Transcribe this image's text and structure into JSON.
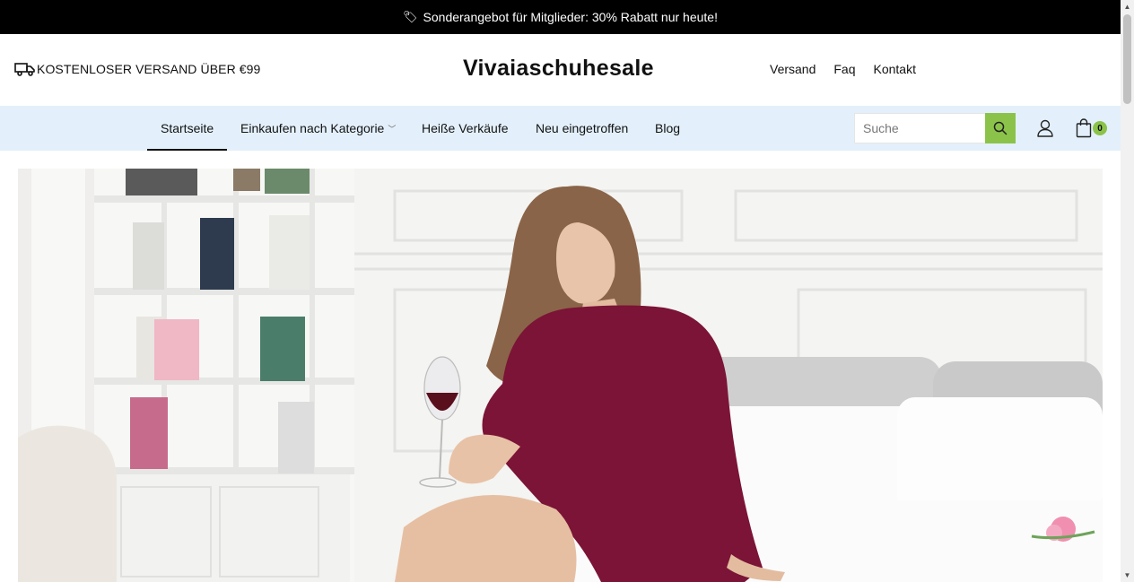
{
  "announcement": {
    "icon": "tag-icon",
    "text": "Sonderangebot für Mitglieder: 30% Rabatt nur heute!"
  },
  "header": {
    "shipping_icon": "truck-icon",
    "shipping_text": "KOSTENLOSER VERSAND ÜBER €99",
    "logo": "Vivaiaschuhesale",
    "links": [
      "Versand",
      "Faq",
      "Kontakt"
    ]
  },
  "nav": {
    "items": [
      "Startseite",
      "Einkaufen nach Kategorie",
      "Heiße Verkäufe",
      "Neu eingetroffen",
      "Blog"
    ],
    "active": "Startseite",
    "dropdown_icon": "chevron-down-icon"
  },
  "search": {
    "placeholder": "Suche",
    "icon": "search-icon"
  },
  "account": {
    "icon": "user-icon"
  },
  "cart": {
    "icon": "shopping-bag-icon",
    "count": "0"
  },
  "hero": {
    "image": "Woman in burgundy velvet wrap dress holding a glass of red wine, seated on a white bed beside a bookshelf"
  },
  "colors": {
    "announcement_bg": "#000000",
    "nav_bg": "#e3f0fb",
    "accent": "#8bc34a"
  }
}
